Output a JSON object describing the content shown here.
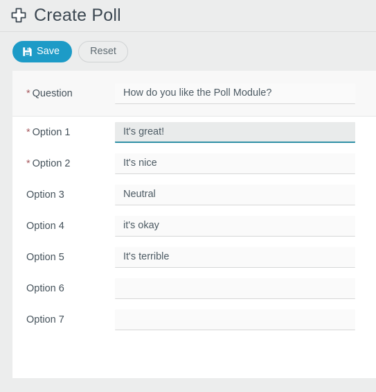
{
  "header": {
    "icon": "plus-icon",
    "title": "Create Poll"
  },
  "toolbar": {
    "save_label": "Save",
    "save_icon": "save-icon",
    "reset_label": "Reset",
    "accent_color": "#1d9bc7",
    "reset_text_color": "#5f6b72"
  },
  "form": {
    "required_marker": "*",
    "required_color": "#a65a5f",
    "focus_color": "#2f8fa6",
    "question": {
      "label": "Question",
      "required": true,
      "value": "How do you like the Poll Module?",
      "placeholder": ""
    },
    "options": [
      {
        "label": "Option 1",
        "required": true,
        "value": "It's great!",
        "placeholder": "",
        "focused": true
      },
      {
        "label": "Option 2",
        "required": true,
        "value": "It's nice",
        "placeholder": "",
        "focused": false
      },
      {
        "label": "Option 3",
        "required": false,
        "value": "Neutral",
        "placeholder": "",
        "focused": false
      },
      {
        "label": "Option 4",
        "required": false,
        "value": "it's okay",
        "placeholder": "",
        "focused": false
      },
      {
        "label": "Option 5",
        "required": false,
        "value": "It's terrible",
        "placeholder": "",
        "focused": false
      },
      {
        "label": "Option 6",
        "required": false,
        "value": "",
        "placeholder": "",
        "focused": false
      },
      {
        "label": "Option 7",
        "required": false,
        "value": "",
        "placeholder": "",
        "focused": false
      }
    ]
  }
}
